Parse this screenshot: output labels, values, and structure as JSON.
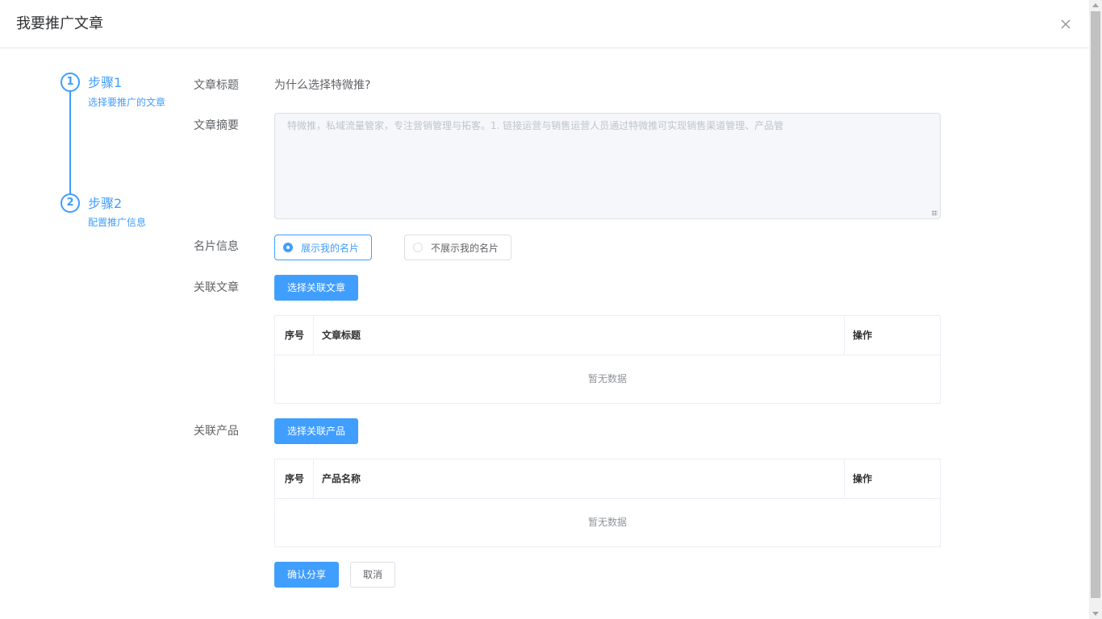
{
  "dialog": {
    "title": "我要推广文章",
    "close_icon": "close-icon"
  },
  "steps": [
    {
      "number": "1",
      "title": "步骤1",
      "desc": "选择要推广的文章"
    },
    {
      "number": "2",
      "title": "步骤2",
      "desc": "配置推广信息"
    }
  ],
  "form": {
    "title_label": "文章标题",
    "title_value": "为什么选择特微推?",
    "summary_label": "文章摘要",
    "summary_value": "特微推，私域流量管家，专注营销管理与拓客。1.  链接运营与销售运营人员通过特微推可实现销售渠道管理、产品管",
    "card_label": "名片信息",
    "card_options": [
      {
        "label": "展示我的名片",
        "checked": true
      },
      {
        "label": "不展示我的名片",
        "checked": false
      }
    ],
    "related_article_label": "关联文章",
    "select_article_button": "选择关联文章",
    "related_product_label": "关联产品",
    "select_product_button": "选择关联产品"
  },
  "article_table": {
    "columns": [
      "序号",
      "文章标题",
      "操作"
    ],
    "empty_text": "暂无数据"
  },
  "product_table": {
    "columns": [
      "序号",
      "产品名称",
      "操作"
    ],
    "empty_text": "暂无数据"
  },
  "footer": {
    "confirm_button": "确认分享",
    "cancel_button": "取消"
  },
  "colors": {
    "primary": "#409eff",
    "text": "#606266",
    "border": "#dcdfe6"
  }
}
